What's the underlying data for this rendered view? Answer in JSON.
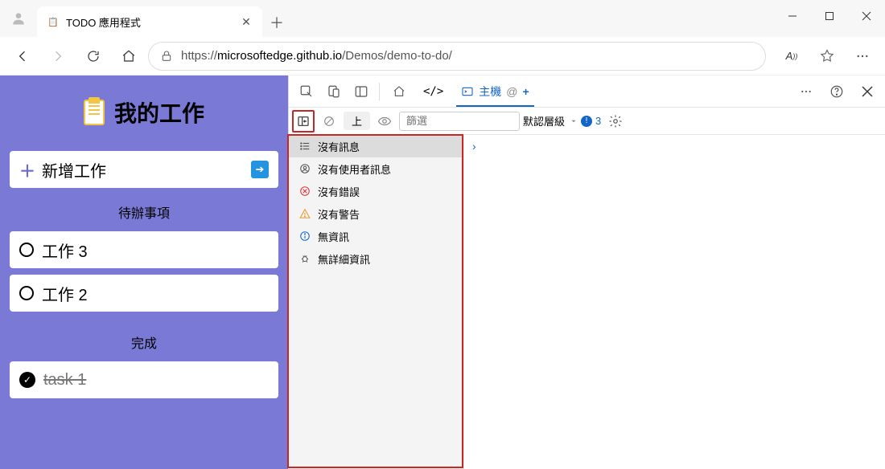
{
  "browser": {
    "tab_title": "TODO 應用程式",
    "url_prefix": "https://",
    "url_host": "microsoftedge.github.io",
    "url_path": "/Demos/demo-to-do/"
  },
  "page": {
    "title": "我的工作",
    "add_task": "新增工作",
    "pending_header": "待辦事項",
    "done_header": "完成",
    "tasks_pending": [
      {
        "label": "工作 3"
      },
      {
        "label": "工作 2"
      }
    ],
    "tasks_done": [
      {
        "label": "task 1"
      }
    ]
  },
  "devtools": {
    "active_tab_label": "主機",
    "active_tab_suffix": "@",
    "toolbar": {
      "context": "上",
      "filter_placeholder": "篩選",
      "levels_label": "默認層級",
      "issue_count": "3"
    },
    "sidebar_items": [
      {
        "id": "messages",
        "label": "沒有訊息",
        "icon": "list",
        "selected": true
      },
      {
        "id": "user",
        "label": "沒有使用者訊息",
        "icon": "user",
        "selected": false
      },
      {
        "id": "errors",
        "label": "沒有錯誤",
        "icon": "error",
        "selected": false
      },
      {
        "id": "warnings",
        "label": "沒有警告",
        "icon": "warning",
        "selected": false
      },
      {
        "id": "info",
        "label": "無資訊",
        "icon": "info",
        "selected": false
      },
      {
        "id": "verbose",
        "label": "無詳細資訊",
        "icon": "bug",
        "selected": false
      }
    ]
  }
}
